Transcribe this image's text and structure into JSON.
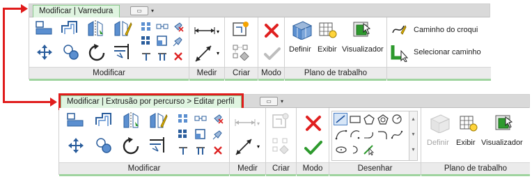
{
  "top_ribbon": {
    "context_tab": "Modificar | Varredura",
    "panels": {
      "modify": "Modificar",
      "measure": "Medir",
      "create": "Criar",
      "mode": "Modo",
      "work_plane": "Plano de trabalho"
    },
    "buttons": {
      "set": "Definir",
      "show": "Exibir",
      "viewer": "Visualizador",
      "sketch_path": "Caminho do croqui",
      "pick_path": "Selecionar caminho"
    }
  },
  "bottom_ribbon": {
    "context_tab": "Modificar | Extrusão por percurso > Editar perfil",
    "panels": {
      "modify": "Modificar",
      "measure": "Medir",
      "create": "Criar",
      "mode": "Modo",
      "draw": "Desenhar",
      "work_plane": "Plano de trabalho"
    },
    "buttons": {
      "set": "Definir",
      "show": "Exibir",
      "viewer": "Visualizador"
    }
  },
  "colors": {
    "highlight": "#e01b1b",
    "context_tab_bg": "#dff4e0",
    "panel_label_bg": "#ebebeb",
    "accent_green_bar": "#9fd49f"
  }
}
